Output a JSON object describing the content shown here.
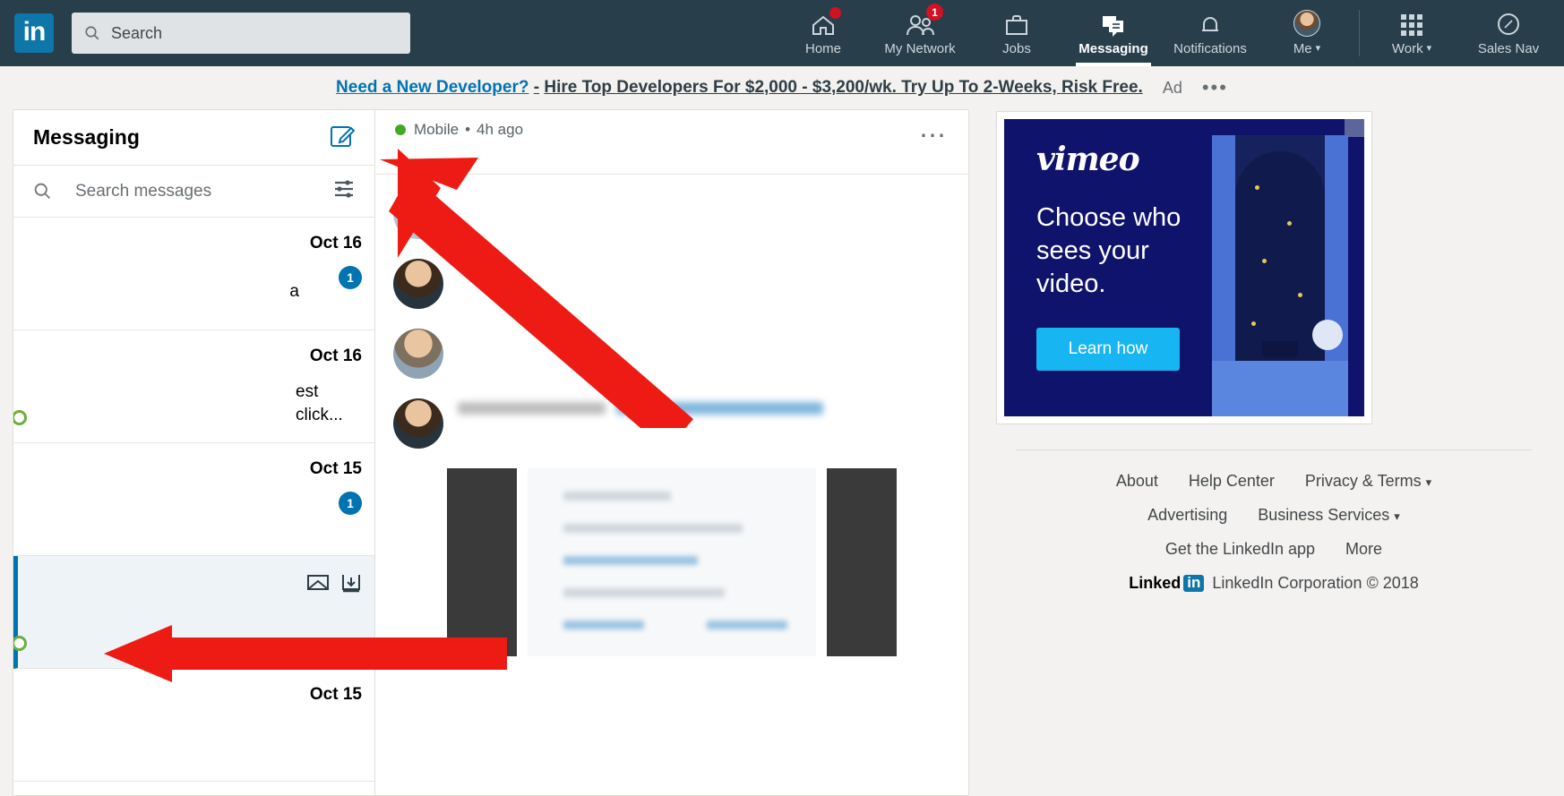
{
  "topnav": {
    "logo_text": "in",
    "search": {
      "placeholder": "Search",
      "value": "",
      "icon": "search-icon"
    },
    "items": [
      {
        "label": "Home",
        "icon": "home-icon",
        "badge": "",
        "badge_dot": true,
        "active": false
      },
      {
        "label": "My Network",
        "icon": "people-icon",
        "badge": "1",
        "badge_dot": false,
        "active": false
      },
      {
        "label": "Jobs",
        "icon": "briefcase-icon",
        "badge": "",
        "badge_dot": false,
        "active": false
      },
      {
        "label": "Messaging",
        "icon": "message-icon",
        "badge": "",
        "badge_dot": false,
        "active": true
      },
      {
        "label": "Notifications",
        "icon": "bell-icon",
        "badge": "",
        "badge_dot": false,
        "active": false
      },
      {
        "label": "Me",
        "icon": "avatar-icon",
        "badge": "",
        "badge_dot": false,
        "active": false,
        "caret": "▾"
      }
    ],
    "right_items": [
      {
        "label": "Work",
        "icon": "grid-icon",
        "caret": "▾"
      },
      {
        "label": "Sales Nav",
        "icon": "compass-icon",
        "caret": ""
      }
    ]
  },
  "ad_banner": {
    "link_text": "Need a New Developer?",
    "separator": "-",
    "tagline": "Hire Top Developers For $2,000 - $3,200/wk. Try Up To 2-Weeks, Risk Free.",
    "ad_label": "Ad",
    "more": "•••"
  },
  "messaging": {
    "title": "Messaging",
    "compose_icon": "compose-pencil-icon",
    "search": {
      "placeholder": "Search messages",
      "value": "",
      "icon": "search-icon",
      "filter_icon": "filter-sliders-icon"
    },
    "conversations": [
      {
        "date": "Oct 16",
        "unread": "1",
        "selected": false,
        "presence": false,
        "snippet_fragment": "a",
        "actions": []
      },
      {
        "date": "Oct 16",
        "unread": "",
        "selected": false,
        "presence": true,
        "snippet_fragment": "est click...",
        "actions": []
      },
      {
        "date": "Oct 15",
        "unread": "1",
        "selected": false,
        "presence": false,
        "snippet_fragment": "",
        "actions": []
      },
      {
        "date": "",
        "unread": "",
        "selected": true,
        "presence": true,
        "snippet_fragment": "",
        "actions": [
          "envelope-icon",
          "archive-icon"
        ]
      },
      {
        "date": "Oct 15",
        "unread": "",
        "selected": false,
        "presence": false,
        "snippet_fragment": "",
        "actions": []
      }
    ]
  },
  "thread": {
    "presence_label": "Mobile",
    "separator": "•",
    "timestamp": "4h ago",
    "more_icon": "overflow-dots-icon",
    "messages": [
      {
        "has_link": false,
        "has_emoji": false,
        "lines": 2
      },
      {
        "has_link": false,
        "has_emoji": false,
        "lines": 1
      },
      {
        "has_link": false,
        "has_emoji": true,
        "lines": 1
      },
      {
        "has_link": true,
        "has_emoji": false,
        "lines": 3
      }
    ]
  },
  "rail_ad": {
    "brand": "vimeo",
    "headline": "Choose who sees your video.",
    "cta": "Learn how",
    "close_icon": "close-icon",
    "bg_color": "#10136b",
    "cta_color": "#17b5f1"
  },
  "footer": {
    "row1": [
      {
        "label": "About",
        "chevron": false
      },
      {
        "label": "Help Center",
        "chevron": false
      },
      {
        "label": "Privacy & Terms",
        "chevron": true
      }
    ],
    "row2": [
      {
        "label": "Advertising",
        "chevron": false
      },
      {
        "label": "Business Services",
        "chevron": true
      }
    ],
    "row3": [
      {
        "label": "Get the LinkedIn app",
        "chevron": false
      },
      {
        "label": "More",
        "chevron": false
      }
    ],
    "brand_word": "Linked",
    "brand_box": "in",
    "copyright": "LinkedIn Corporation © 2018"
  },
  "annotations": {
    "arrow_color": "#ee1b14",
    "arrows": [
      {
        "name": "arrow-to-thread-header"
      },
      {
        "name": "arrow-to-selected-conversation"
      }
    ]
  }
}
